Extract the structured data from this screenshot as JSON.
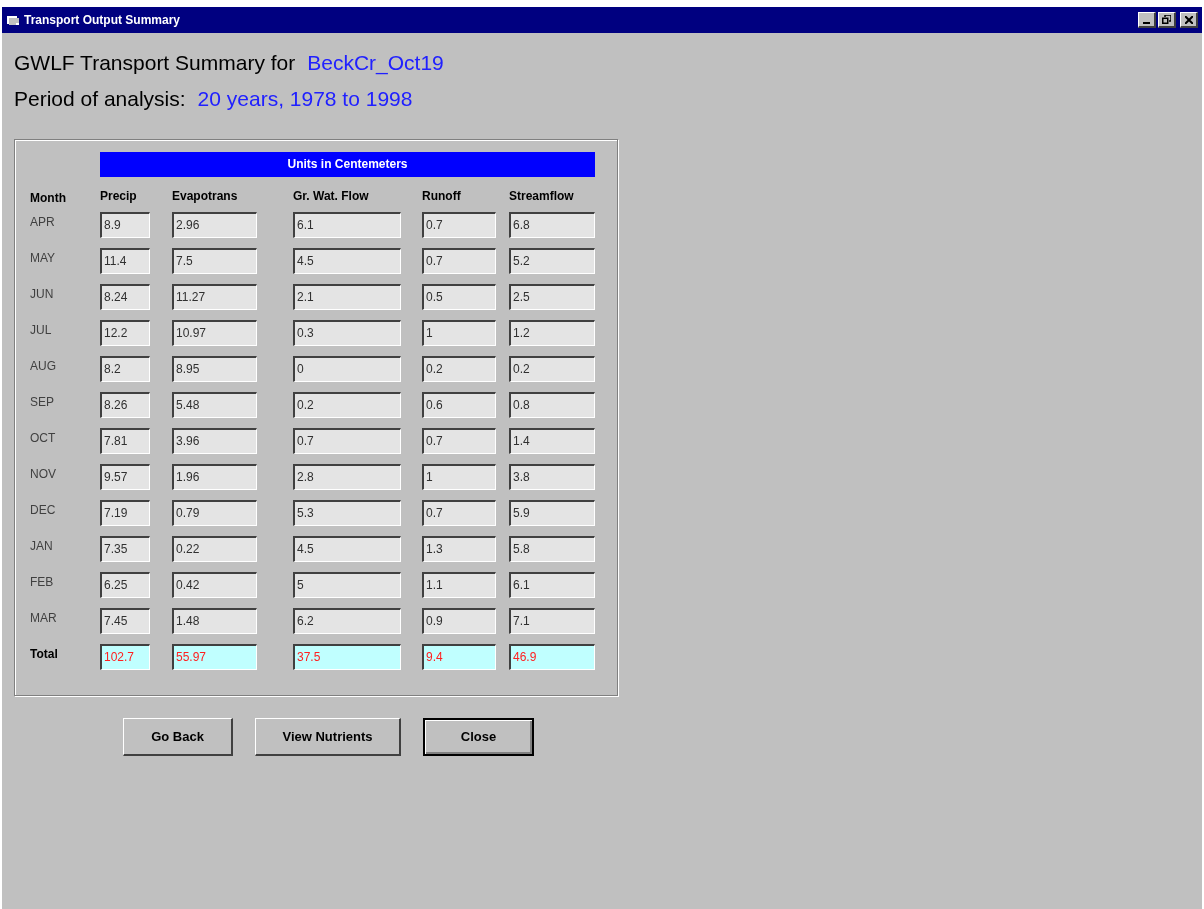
{
  "window": {
    "title": "Transport Output Summary"
  },
  "heading": {
    "label": "GWLF Transport Summary for",
    "value": "BeckCr_Oct19"
  },
  "period": {
    "label": "Period of analysis:",
    "value": "20 years,  1978 to 1998"
  },
  "units_banner": "Units in Centemeters",
  "month_header": "Month",
  "columns": [
    "Precip",
    "Evapotrans",
    "Gr. Wat. Flow",
    "Runoff",
    "Streamflow"
  ],
  "rows": [
    {
      "month": "APR",
      "values": [
        "8.9",
        "2.96",
        "6.1",
        "0.7",
        "6.8"
      ]
    },
    {
      "month": "MAY",
      "values": [
        "11.4",
        "7.5",
        "4.5",
        "0.7",
        "5.2"
      ]
    },
    {
      "month": "JUN",
      "values": [
        "8.24",
        "11.27",
        "2.1",
        "0.5",
        "2.5"
      ]
    },
    {
      "month": "JUL",
      "values": [
        "12.2",
        "10.97",
        "0.3",
        "1",
        "1.2"
      ]
    },
    {
      "month": "AUG",
      "values": [
        "8.2",
        "8.95",
        "0",
        "0.2",
        "0.2"
      ]
    },
    {
      "month": "SEP",
      "values": [
        "8.26",
        "5.48",
        "0.2",
        "0.6",
        "0.8"
      ]
    },
    {
      "month": "OCT",
      "values": [
        "7.81",
        "3.96",
        "0.7",
        "0.7",
        "1.4"
      ]
    },
    {
      "month": "NOV",
      "values": [
        "9.57",
        "1.96",
        "2.8",
        "1",
        "3.8"
      ]
    },
    {
      "month": "DEC",
      "values": [
        "7.19",
        "0.79",
        "5.3",
        "0.7",
        "5.9"
      ]
    },
    {
      "month": "JAN",
      "values": [
        "7.35",
        "0.22",
        "4.5",
        "1.3",
        "5.8"
      ]
    },
    {
      "month": "FEB",
      "values": [
        "6.25",
        "0.42",
        "5",
        "1.1",
        "6.1"
      ]
    },
    {
      "month": "MAR",
      "values": [
        "7.45",
        "1.48",
        "6.2",
        "0.9",
        "7.1"
      ]
    }
  ],
  "total": {
    "label": "Total",
    "values": [
      "102.7",
      "55.97",
      "37.5",
      "9.4",
      "46.9"
    ]
  },
  "buttons": [
    {
      "label": "Go Back",
      "default": false
    },
    {
      "label": "View Nutrients",
      "default": false
    },
    {
      "label": "Close",
      "default": true
    }
  ]
}
